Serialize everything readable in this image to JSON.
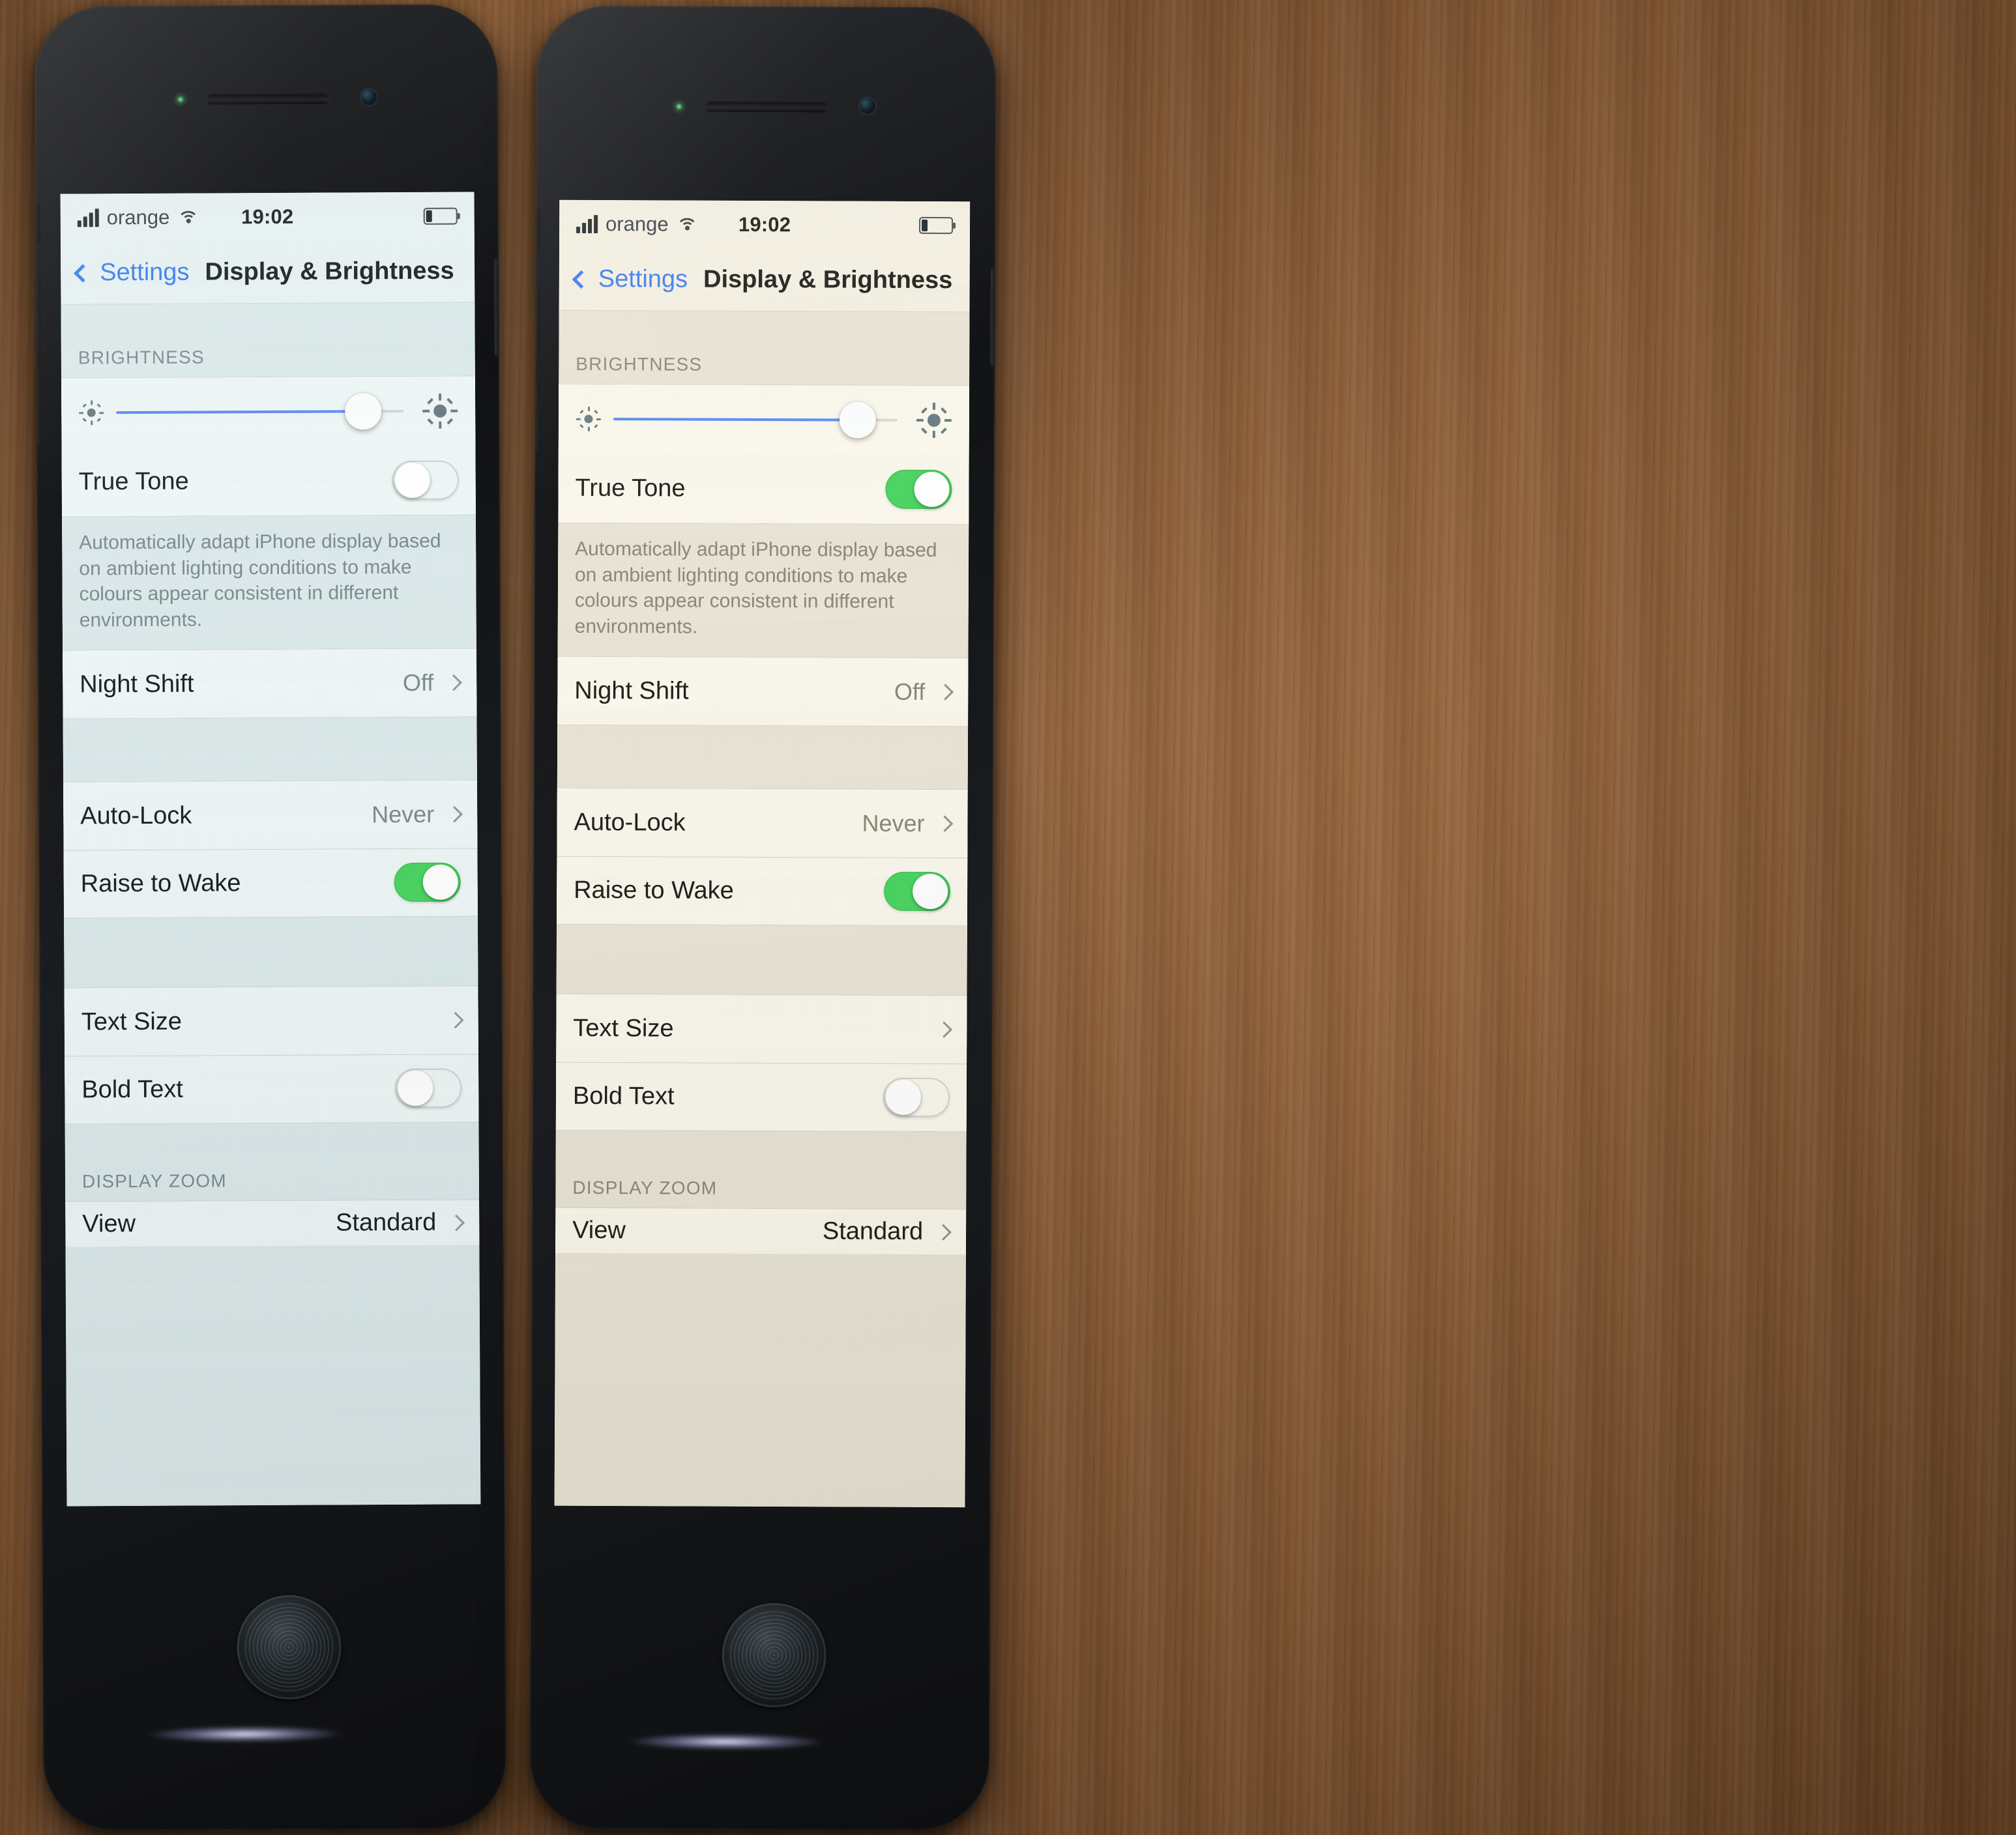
{
  "scene": {
    "description": "Two iPhones side by side on a wooden desk showing iOS Display & Brightness settings",
    "left_caption": "True Tone off (cool white screen)",
    "right_caption": "True Tone on (warm white screen)"
  },
  "status_bar": {
    "carrier": "orange",
    "time": "19:02",
    "signal_bars": 4,
    "wifi_icon": "wifi-icon",
    "battery_icon": "battery-low-icon",
    "battery_level_percent": 18
  },
  "nav": {
    "back_label": "Settings",
    "back_icon": "chevron-left-icon",
    "title": "Display & Brightness"
  },
  "sections": {
    "brightness": {
      "header": "BRIGHTNESS",
      "slider": {
        "name": "brightness-slider",
        "value_percent": 86,
        "low_icon": "sun-small-icon",
        "high_icon": "sun-large-icon"
      },
      "true_tone": {
        "label": "True Tone",
        "left_state": "off",
        "right_state": "on"
      },
      "footnote": "Automatically adapt iPhone display based on ambient lighting conditions to make colours appear consistent in different environments."
    },
    "night_shift": {
      "label": "Night Shift",
      "value": "Off",
      "accessory": "chevron-right-icon"
    },
    "lock": {
      "auto_lock": {
        "label": "Auto-Lock",
        "value": "Never",
        "accessory": "chevron-right-icon"
      },
      "raise_to_wake": {
        "label": "Raise to Wake",
        "state": "on"
      }
    },
    "text": {
      "text_size": {
        "label": "Text Size",
        "accessory": "chevron-right-icon"
      },
      "bold_text": {
        "label": "Bold Text",
        "state": "off"
      }
    },
    "display_zoom": {
      "header": "DISPLAY ZOOM",
      "view": {
        "label": "View",
        "value": "Standard",
        "accessory": "chevron-right-icon"
      }
    }
  },
  "colors": {
    "accent_blue": "#3b7ff2",
    "toggle_on_green": "#4cd563",
    "slider_blue": "#5b8cf5",
    "cool_screen_bg": "#e7f1f1",
    "warm_screen_bg": "#f3efe2",
    "desk_wood": "#8d5c33",
    "phone_body": "#1a1c1f"
  }
}
